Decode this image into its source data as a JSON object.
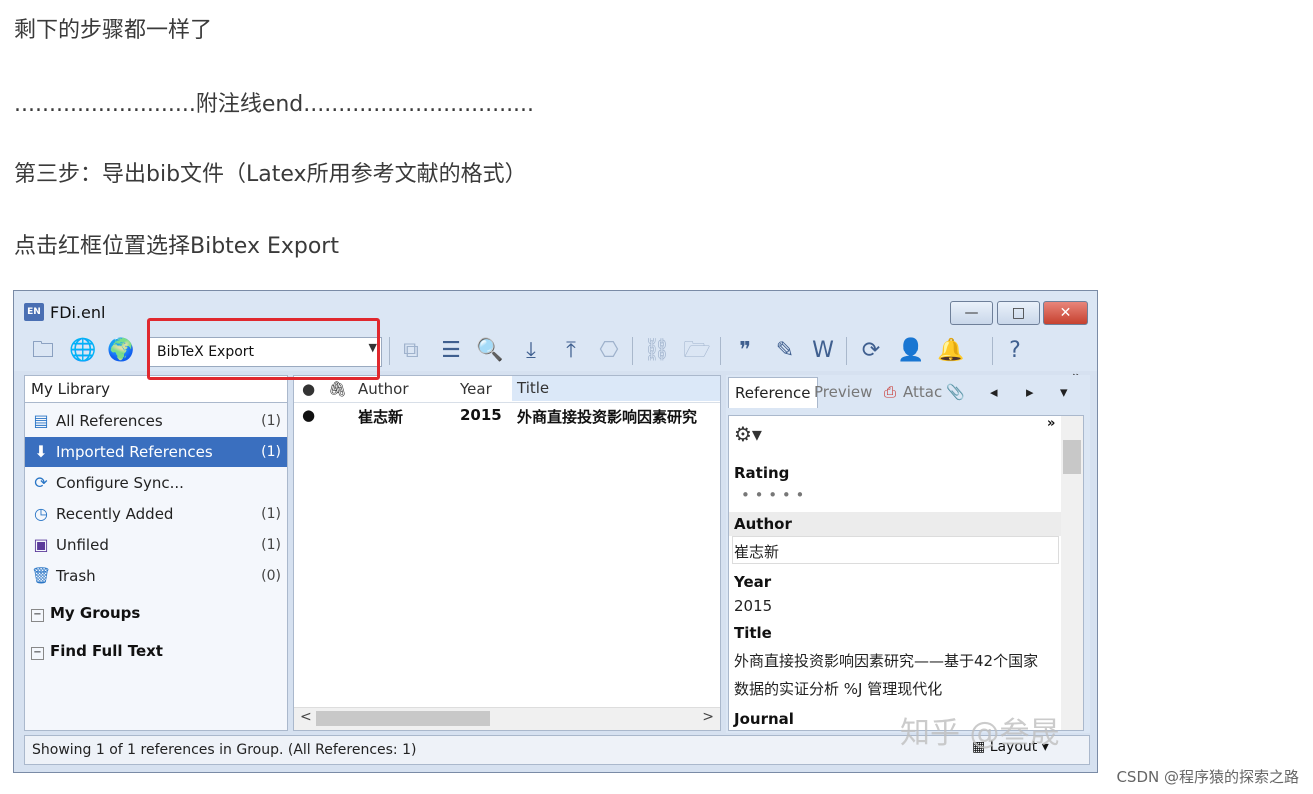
{
  "article": {
    "p1": "剩下的步骤都一样了",
    "p2": "..........................附注线end.................................",
    "p3": "第三步：导出bib文件（Latex所用参考文献的格式）",
    "p4": "点击红框位置选择Bibtex Export"
  },
  "window": {
    "app_icon": "EN",
    "title": "FDi.enl",
    "buttons": {
      "minimize": "—",
      "maximize": "□",
      "close": "✕"
    }
  },
  "toolbar": {
    "output_style": "BibTeX Export",
    "more": "»",
    "icons": [
      "local-library-icon",
      "online-search-icon",
      "integrated-library-icon",
      "copy-icon",
      "new-reference-icon",
      "find-full-text-icon",
      "import-icon",
      "export-icon",
      "open-pdf-icon",
      "open-link-icon",
      "open-file-icon",
      "insert-citation-icon",
      "format-paper-icon",
      "return-to-word-icon",
      "sync-icon",
      "share-icon",
      "recent-activity-icon",
      "help-icon"
    ]
  },
  "sidebar": {
    "header": "My Library",
    "groups": [
      {
        "label": "All References",
        "count": "(1)",
        "icon": "all-references-icon"
      },
      {
        "label": "Imported References",
        "count": "(1)",
        "icon": "import-icon"
      },
      {
        "label": "Configure Sync...",
        "count": "",
        "icon": "sync-icon"
      },
      {
        "label": "Recently Added",
        "count": "(1)",
        "icon": "clock-icon"
      },
      {
        "label": "Unfiled",
        "count": "(1)",
        "icon": "unfiled-icon"
      },
      {
        "label": "Trash",
        "count": "(0)",
        "icon": "trash-icon"
      }
    ],
    "my_groups": "My Groups",
    "find_full_text": "Find Full Text",
    "toggle": "−"
  },
  "reflist": {
    "columns": {
      "author": "Author",
      "year": "Year",
      "title": "Title"
    },
    "rows": [
      {
        "author": "崔志新",
        "year": "2015",
        "title": "外商直接投资影响因素研究"
      }
    ]
  },
  "panel": {
    "tabs": {
      "reference": "Reference",
      "preview": "Preview",
      "attach": "Attac"
    },
    "rating_label": "Rating",
    "rating_dots": "• • • • •",
    "author_label": "Author",
    "author_value": "崔志新",
    "year_label": "Year",
    "year_value": "2015",
    "title_label": "Title",
    "title_line1": "外商直接投资影响因素研究——基于42个国家",
    "title_line2": "数据的实证分析 %J 管理现代化",
    "journal_label": "Journal",
    "more": "»"
  },
  "status": {
    "text": "Showing 1 of 1 references in Group. (All References: 1)",
    "layout": "Layout"
  },
  "watermark": "知乎 @叁晟",
  "csdn": "CSDN @程序猿的探索之路",
  "colors": {
    "selection": "#3a6fbf",
    "highlight_box": "#e0282e",
    "window_bg": "#d6e1f0"
  }
}
